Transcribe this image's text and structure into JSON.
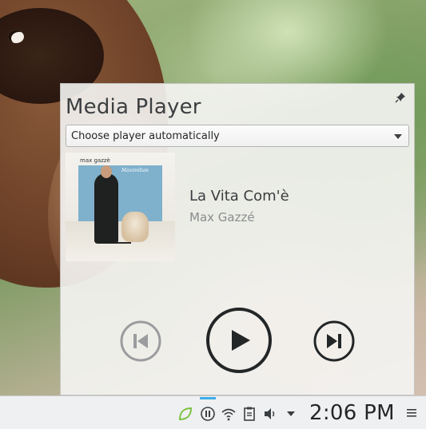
{
  "widget": {
    "title": "Media Player",
    "player_select_value": "Choose player automatically"
  },
  "album_art": {
    "artist_text": "max gazzè",
    "script_text": "Maximilian"
  },
  "track": {
    "title": "La Vita Com'è",
    "artist": "Max Gazzé"
  },
  "controls": {
    "previous_icon": "skip-previous-icon",
    "play_icon": "play-icon",
    "next_icon": "skip-next-icon"
  },
  "panel": {
    "tray_icons": [
      "leaf-icon",
      "media-pause-icon",
      "wifi-icon",
      "clipboard-icon",
      "volume-icon",
      "expand-arrow-icon"
    ],
    "clock": "2:06 PM",
    "menu_icon": "hamburger-icon"
  },
  "colors": {
    "accent": "#3daee9",
    "text": "#3b3d40",
    "secondary_text": "#8a8c8e",
    "leaf_icon": "#7cc242"
  }
}
